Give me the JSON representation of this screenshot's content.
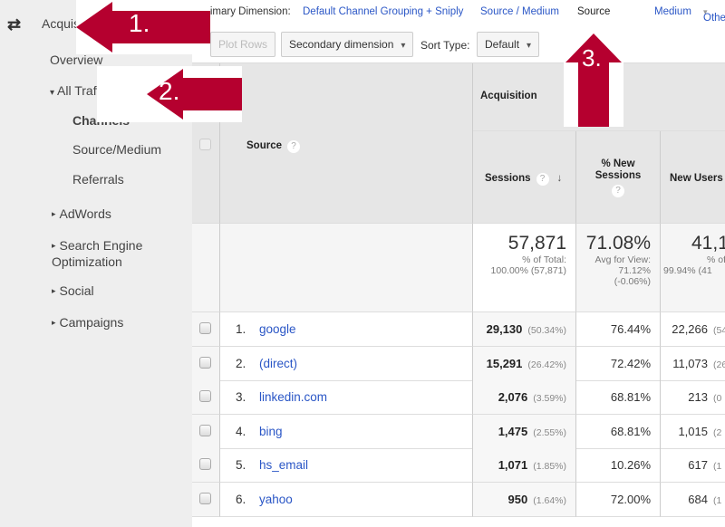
{
  "sidebar": {
    "section": "Acquisition",
    "items": [
      {
        "label": "Overview"
      },
      {
        "label": "All Traffic"
      },
      {
        "label": "Channels"
      },
      {
        "label": "Source/Medium"
      },
      {
        "label": "Referrals"
      },
      {
        "label": "AdWords"
      },
      {
        "label": "Search Engine Optimization"
      },
      {
        "label": "Social"
      },
      {
        "label": "Campaigns"
      }
    ]
  },
  "dimension_bar": {
    "label": "rimary Dimension:",
    "options": [
      "Default Channel Grouping + Sniply",
      "Source / Medium",
      "Source",
      "Medium",
      "Other"
    ],
    "selected": "Source"
  },
  "toolbar": {
    "plot_rows": "Plot Rows",
    "secondary": "Secondary dimension",
    "sort_label": "Sort Type:",
    "sort_value": "Default"
  },
  "table": {
    "group_header": "Acquisition",
    "columns": [
      "Source",
      "Sessions",
      "% New Sessions",
      "New Users"
    ],
    "totals": {
      "sessions": "57,871",
      "sessions_sub1": "% of Total:",
      "sessions_sub2": "100.00% (57,871)",
      "new_sessions": "71.08%",
      "new_sessions_sub1": "Avg for View:",
      "new_sessions_sub2": "71.12%",
      "new_sessions_sub3": "(-0.06%)",
      "new_users": "41,1",
      "new_users_sub1": "% of",
      "new_users_sub2": "99.94% (41"
    },
    "rows": [
      {
        "rank": "1.",
        "source": "google",
        "sessions": "29,130",
        "sessions_pct": "(50.34%)",
        "new_sessions": "76.44%",
        "new_users": "22,266",
        "new_users_pct": "(54"
      },
      {
        "rank": "2.",
        "source": "(direct)",
        "sessions": "15,291",
        "sessions_pct": "(26.42%)",
        "new_sessions": "72.42%",
        "new_users": "11,073",
        "new_users_pct": "(26"
      },
      {
        "rank": "3.",
        "source": "linkedin.com",
        "sessions": "2,076",
        "sessions_pct": "(3.59%)",
        "new_sessions": "68.81%",
        "new_users": "213",
        "new_users_pct": "(0"
      },
      {
        "rank": "4.",
        "source": "bing",
        "sessions": "1,475",
        "sessions_pct": "(2.55%)",
        "new_sessions": "68.81%",
        "new_users": "1,015",
        "new_users_pct": "(2"
      },
      {
        "rank": "5.",
        "source": "hs_email",
        "sessions": "1,071",
        "sessions_pct": "(1.85%)",
        "new_sessions": "10.26%",
        "new_users": "617",
        "new_users_pct": "(1"
      },
      {
        "rank": "6.",
        "source": "yahoo",
        "sessions": "950",
        "sessions_pct": "(1.64%)",
        "new_sessions": "72.00%",
        "new_users": "684",
        "new_users_pct": "(1"
      }
    ]
  },
  "annotations": [
    "1.",
    "2.",
    "3."
  ],
  "colors": {
    "arrow": "#b5002f",
    "link": "#2a56c6",
    "sidebar_bg": "#eeeeee",
    "header_bg": "#e6e6e6"
  }
}
